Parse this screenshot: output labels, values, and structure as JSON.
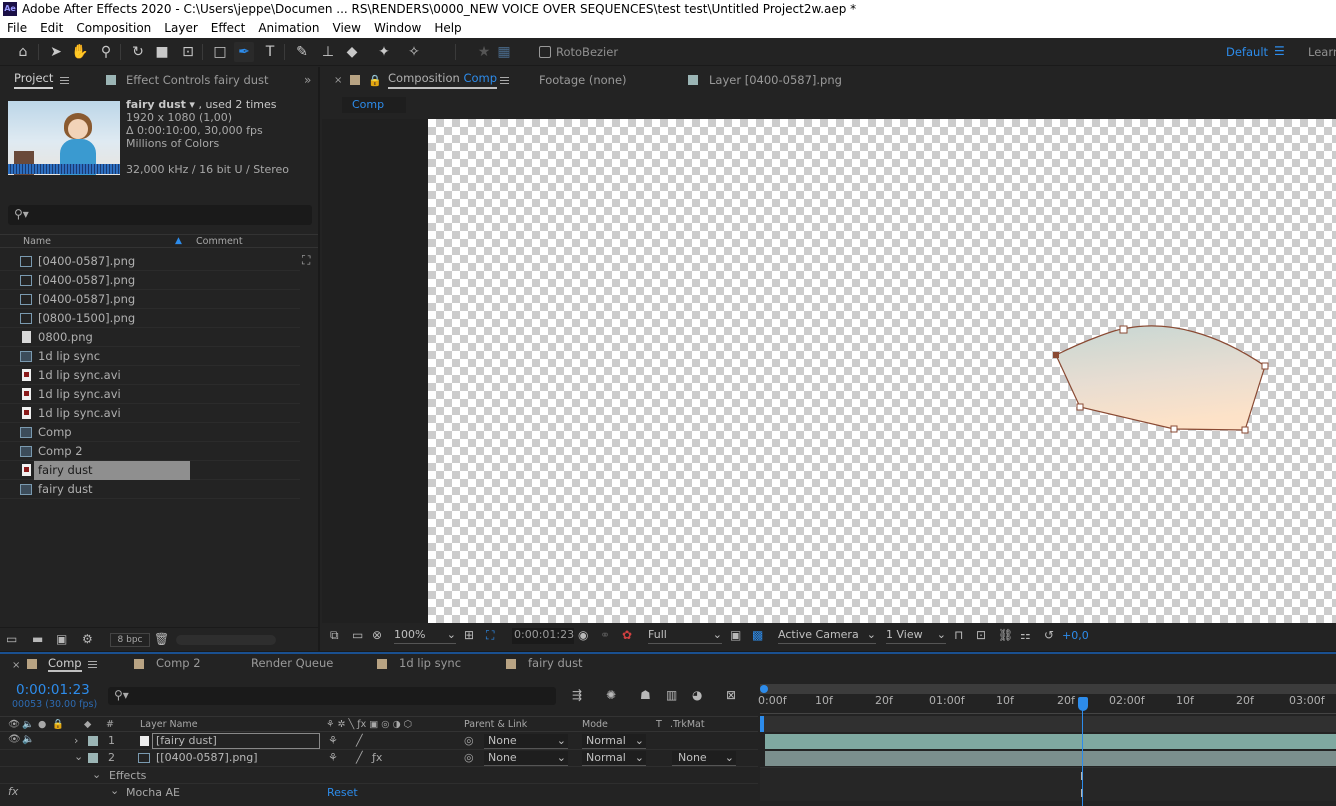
{
  "window": {
    "app_icon": "Ae",
    "title": "Adobe After Effects 2020 - C:\\Users\\jeppe\\Documen ... RS\\RENDERS\\0000_NEW VOICE OVER SEQUENCES\\test test\\Untitled Project2w.aep *"
  },
  "menu": [
    "File",
    "Edit",
    "Composition",
    "Layer",
    "Effect",
    "Animation",
    "View",
    "Window",
    "Help"
  ],
  "toolbar": {
    "roto_bezier": "RotoBezier",
    "workspace": "Default",
    "learn": "Learn"
  },
  "project_panel": {
    "tab_project": "Project",
    "tab_effect_controls": "Effect Controls fairy dust",
    "selected_name": "fairy dust",
    "used": ", used 2 times",
    "dimensions": "1920 x 1080 (1,00)",
    "duration": "Δ 0:00:10:00, 30,000 fps",
    "colors": "Millions of Colors",
    "audio": "32,000 kHz / 16 bit U / Stereo",
    "search_placeholder": "",
    "col_name": "Name",
    "col_comment": "Comment",
    "items": [
      {
        "name": "[0400-0587].png",
        "type": "seq"
      },
      {
        "name": "[0400-0587].png",
        "type": "seq"
      },
      {
        "name": "[0400-0587].png",
        "type": "seq"
      },
      {
        "name": "[0800-1500].png",
        "type": "seq"
      },
      {
        "name": "0800.png",
        "type": "file"
      },
      {
        "name": "1d lip sync",
        "type": "comp"
      },
      {
        "name": "1d lip sync.avi",
        "type": "avi"
      },
      {
        "name": "1d lip sync.avi",
        "type": "avi"
      },
      {
        "name": "1d lip sync.avi",
        "type": "avi"
      },
      {
        "name": "Comp",
        "type": "comp"
      },
      {
        "name": "Comp 2",
        "type": "comp"
      },
      {
        "name": "fairy dust",
        "type": "avi",
        "selected": true
      },
      {
        "name": "fairy dust",
        "type": "comp"
      }
    ],
    "bpc": "8 bpc"
  },
  "viewer": {
    "tab_composition": "Composition",
    "tab_composition_name": "Comp",
    "tab_footage": "Footage  (none)",
    "tab_layer": "Layer  [0400-0587].png",
    "breadcrumb": "Comp",
    "zoom": "100%",
    "timecode": "0:00:01:23",
    "resolution": "Full",
    "camera": "Active Camera",
    "views": "1 View",
    "exposure": "+0,0"
  },
  "timeline": {
    "tabs": [
      "Comp",
      "Comp 2",
      "Render Queue",
      "1d lip sync",
      "fairy dust"
    ],
    "current_time": "0:00:01:23",
    "frame_info": "00053 (30.00 fps)",
    "col_hash": "#",
    "col_layer_name": "Layer Name",
    "col_parent": "Parent & Link",
    "col_mode": "Mode",
    "col_t": "T",
    "col_trkmat": ".TrkMat",
    "layers": [
      {
        "num": "1",
        "name": "[fairy dust]",
        "parent": "None",
        "mode": "Normal",
        "trkmat": ""
      },
      {
        "num": "2",
        "name": "[[0400-0587].png]",
        "parent": "None",
        "mode": "Normal",
        "trkmat": "None"
      }
    ],
    "effects_label": "Effects",
    "fx_label": "fx",
    "mocha_label": "Mocha AE",
    "reset_label": "Reset",
    "ruler": [
      "0:00f",
      "10f",
      "20f",
      "01:00f",
      "10f",
      "20f",
      "02:00f",
      "10f",
      "20f",
      "03:00f"
    ]
  },
  "colors": {
    "accent_blue": "#2d8ceb",
    "panel_bg": "#232323",
    "layer_bar": "#7fa9a1"
  }
}
